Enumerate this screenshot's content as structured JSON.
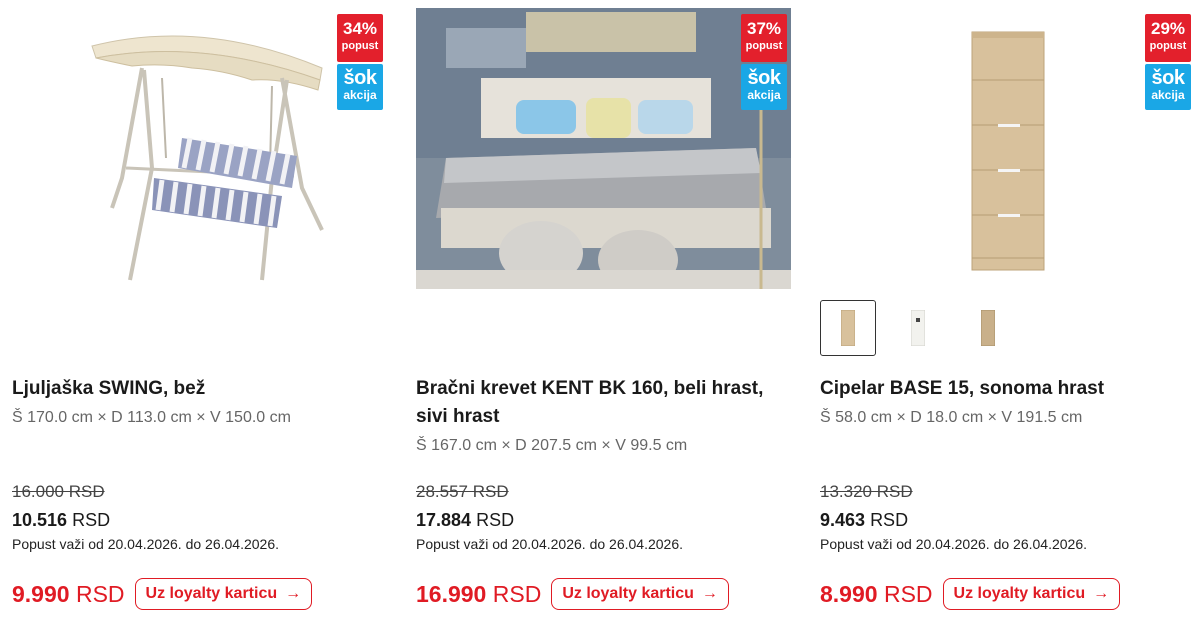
{
  "products": [
    {
      "title": "Ljuljaška SWING, bež",
      "dimensions": "Š 170.0 cm × D 113.0 cm × V 150.0 cm",
      "old_price": "16.000 RSD",
      "new_price_value": "10.516",
      "new_price_currency": "RSD",
      "validity": "Popust važi od 20.04.2026. do 26.04.2026.",
      "loyalty_price_value": "9.990",
      "loyalty_price_currency": "RSD",
      "loyalty_label": "Uz loyalty karticu",
      "discount_badge": {
        "percent": "34%",
        "label": "popust"
      },
      "promo_badge": {
        "line1": "šok",
        "line2": "akcija"
      }
    },
    {
      "title": "Bračni krevet KENT BK 160, beli hrast, sivi hrast",
      "dimensions": "Š 167.0 cm × D 207.5 cm × V 99.5 cm",
      "old_price": "28.557 RSD",
      "new_price_value": "17.884",
      "new_price_currency": "RSD",
      "validity": "Popust važi od 20.04.2026. do 26.04.2026.",
      "loyalty_price_value": "16.990",
      "loyalty_price_currency": "RSD",
      "loyalty_label": "Uz loyalty karticu",
      "discount_badge": {
        "percent": "37%",
        "label": "popust"
      },
      "promo_badge": {
        "line1": "šok",
        "line2": "akcija"
      }
    },
    {
      "title": "Cipelar BASE 15, sonoma hrast",
      "dimensions": "Š 58.0 cm × D 18.0 cm × V 191.5 cm",
      "old_price": "13.320 RSD",
      "new_price_value": "9.463",
      "new_price_currency": "RSD",
      "validity": "Popust važi od 20.04.2026. do 26.04.2026.",
      "loyalty_price_value": "8.990",
      "loyalty_price_currency": "RSD",
      "loyalty_label": "Uz loyalty karticu",
      "discount_badge": {
        "percent": "29%",
        "label": "popust"
      },
      "promo_badge": {
        "line1": "šok",
        "line2": "akcija"
      },
      "color_variants": [
        "sonoma-oak",
        "white",
        "light-oak"
      ]
    }
  ],
  "colors": {
    "accent_red": "#e01b24",
    "badge_red": "#e3202c",
    "badge_blue": "#1aa7e6"
  }
}
